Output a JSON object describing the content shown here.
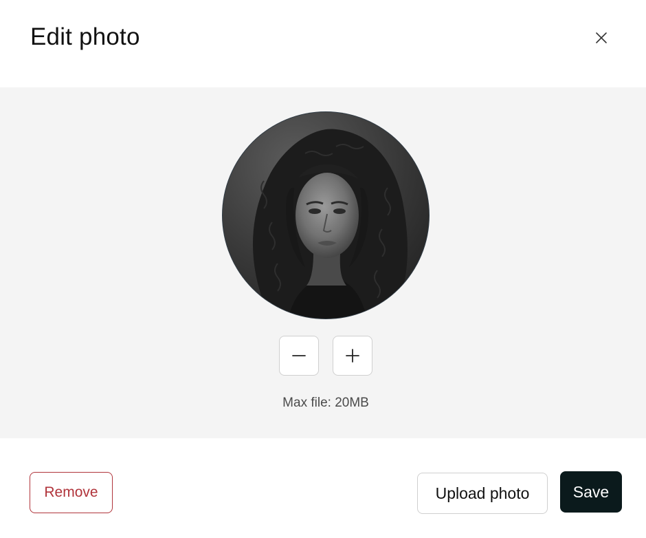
{
  "dialog": {
    "title": "Edit photo",
    "close_icon": "close-icon"
  },
  "editor": {
    "avatar_alt": "Profile photo preview",
    "zoom_out_icon": "minus-icon",
    "zoom_in_icon": "plus-icon",
    "max_file_text": "Max file: 20MB"
  },
  "footer": {
    "remove_label": "Remove",
    "upload_label": "Upload photo",
    "save_label": "Save"
  },
  "colors": {
    "danger": "#b0333a",
    "primary": "#0b1a1c",
    "editor_bg": "#f4f4f4"
  }
}
